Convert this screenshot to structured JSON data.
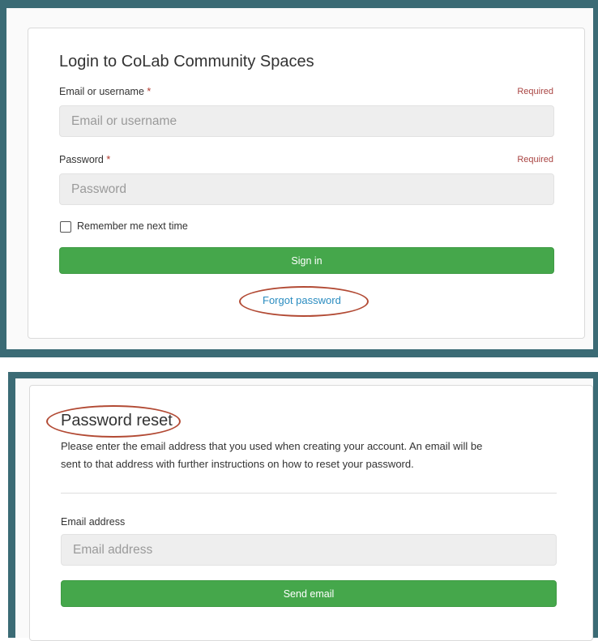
{
  "login": {
    "title": "Login to CoLab Community Spaces",
    "email_label": "Email or username",
    "email_placeholder": "Email or username",
    "password_label": "Password",
    "password_placeholder": "Password",
    "required_star": "*",
    "required_text": "Required",
    "remember_label": "Remember me next time",
    "remember_checked": false,
    "signin_label": "Sign in",
    "forgot_label": "Forgot password"
  },
  "reset": {
    "title": "Password reset",
    "description_line1": "Please enter the email address that you used when creating your account. An email will be",
    "description_line2": "sent to that address with further instructions on how to reset your password.",
    "email_label": "Email address",
    "email_placeholder": "Email address",
    "send_label": "Send email"
  },
  "colors": {
    "frame": "#3b6b75",
    "button": "#45a74b",
    "link": "#2a8cc0",
    "highlight": "#b24a34",
    "required": "#a94442"
  }
}
